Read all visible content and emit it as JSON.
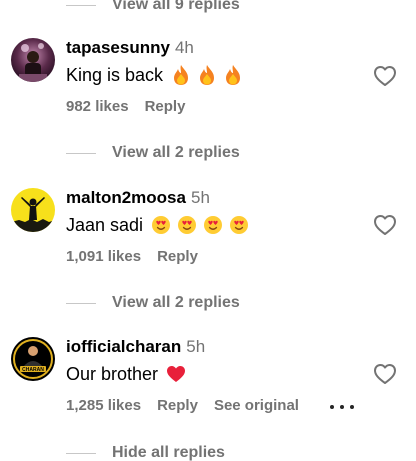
{
  "top_replies": {
    "label": "View all 9 replies"
  },
  "comments": [
    {
      "username": "tapasesunny",
      "time": "4h",
      "text": "King is back",
      "emoji": "fire-emoji",
      "likes": "982 likes",
      "reply_label": "Reply",
      "replies_toggle": "View all 2 replies"
    },
    {
      "username": "malton2moosa",
      "time": "5h",
      "text": "Jaan sadi",
      "emoji": "heart-face-emoji",
      "likes": "1,091 likes",
      "reply_label": "Reply",
      "replies_toggle": "View all 2 replies"
    },
    {
      "username": "iofficialcharan",
      "time": "5h",
      "text": "Our brother",
      "emoji": "red-heart-emoji",
      "likes": "1,285 likes",
      "reply_label": "Reply",
      "see_original": "See original",
      "replies_toggle": "Hide all replies"
    }
  ],
  "colors": {
    "secondary_text": "#737373",
    "divider": "#c7c7c7",
    "heart_red": "#e8203a"
  }
}
